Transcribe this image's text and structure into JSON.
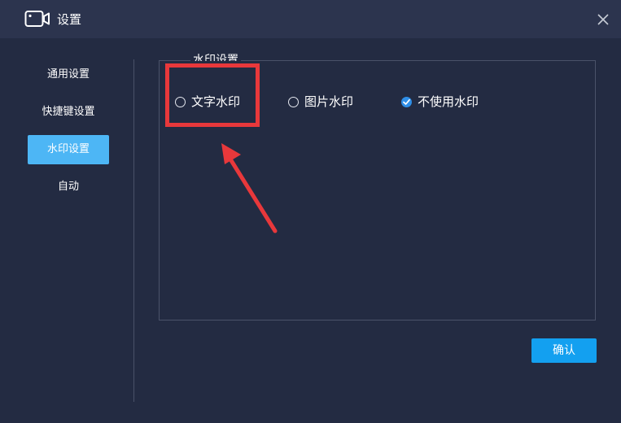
{
  "window": {
    "title": "设置"
  },
  "sidebar": {
    "items": [
      {
        "label": "通用设置",
        "active": false
      },
      {
        "label": "快捷键设置",
        "active": false
      },
      {
        "label": "水印设置",
        "active": true
      },
      {
        "label": "自动",
        "active": false
      }
    ]
  },
  "watermark": {
    "group_title": "水印设置",
    "options": [
      {
        "label": "文字水印",
        "checked": false
      },
      {
        "label": "图片水印",
        "checked": false
      },
      {
        "label": "不使用水印",
        "checked": true
      }
    ]
  },
  "footer": {
    "confirm_label": "确认"
  },
  "colors": {
    "background": "#232b42",
    "titlebar": "#2c344e",
    "accent": "#4db6f5",
    "button": "#13a0f0",
    "radio_checked": "#2f8fe8",
    "annotation": "#e8383b"
  },
  "icons": {
    "app": "video-camera-icon",
    "close": "close-icon",
    "check": "check-icon"
  }
}
